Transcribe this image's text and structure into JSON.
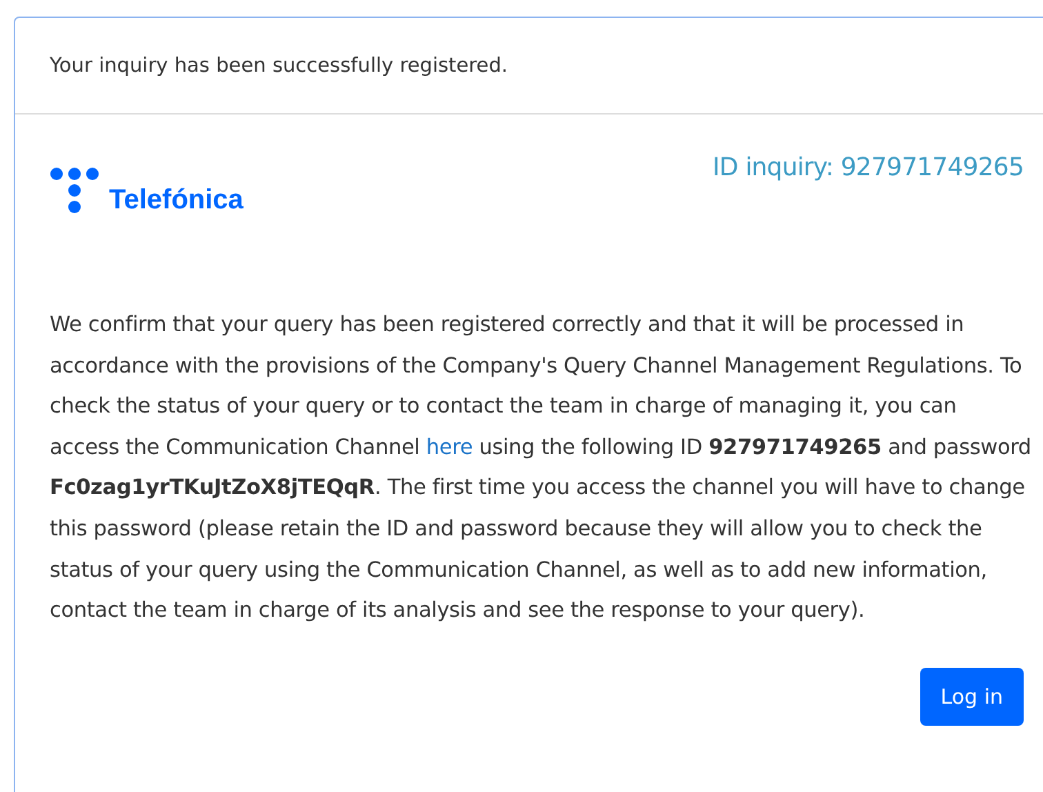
{
  "header": {
    "message": "Your inquiry has been successfully registered."
  },
  "logo": {
    "name": "Telefónica"
  },
  "inquiry_id": "ID inquiry: 927971749265",
  "paragraph": {
    "before": "We confirm that your query has been registered correctly and that it will be processed in accordance with the provisions of the Company's Query Channel Management Regulations. To check the status of your query or to contact the team in charge of managing it, you can access the Communication Channel",
    "link": "here",
    "after": "using the following ID **927971749265** and password **Fc0zag1yrTKuJtZoX8jTEQqR**. The first time you access the channel you will have to change this password (please retain the ID and password because they will allow you to check the status of your query using the Communication Channel, as well as to add new information, contact the team in charge of its analysis and see the response to your query)."
  },
  "buttons": [
    {
      "label": "Log in"
    }
  ]
}
